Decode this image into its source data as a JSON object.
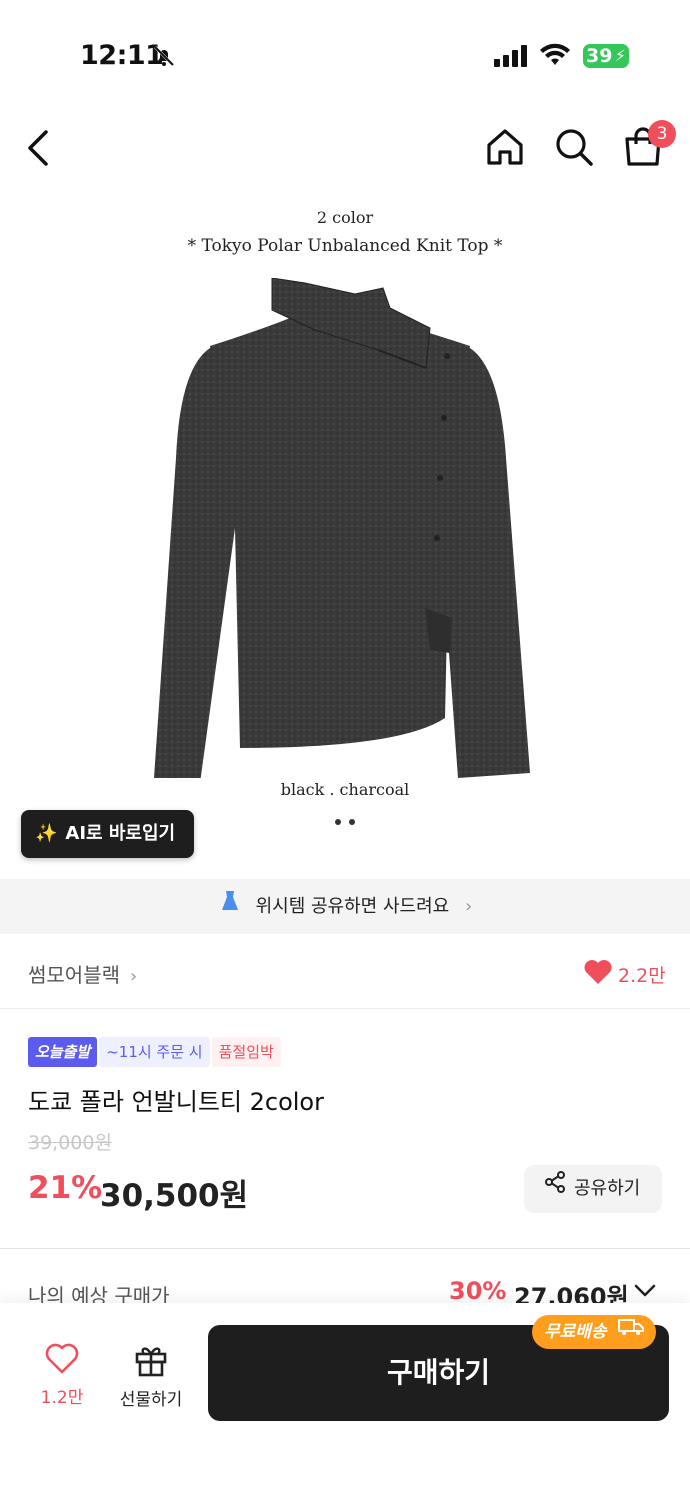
{
  "status_bar": {
    "time": "12:11",
    "battery": "39"
  },
  "header": {
    "cart_count": "3"
  },
  "hero": {
    "caption_top": "2 color",
    "caption_title": "* Tokyo Polar Unbalanced Knit Top *",
    "caption_colors": "black . charcoal",
    "ai_button_label": "AI로 바로입기"
  },
  "wish_banner": {
    "label": "위시템 공유하면 사드려요"
  },
  "brand": {
    "name": "썸모어블랙",
    "like_count": "2.2만"
  },
  "product": {
    "badges": [
      "오늘출발",
      "~11시 주문 시",
      "품절임박"
    ],
    "name": "도쿄 폴라 언발니트티 2color",
    "original_price": "39,000원",
    "discount": "21%",
    "sale_price": "30,500원",
    "share_label": "공유하기"
  },
  "expected": {
    "label": "나의 예상 구매가",
    "discount": "30%",
    "price": "27,060원"
  },
  "bottom_bar": {
    "wish_count": "1.2만",
    "gift_label": "선물하기",
    "buy_label": "구매하기",
    "free_shipping_label": "무료배송"
  },
  "colors": {
    "accent_red": "#f14e5b",
    "today_badge": "#5b5bf0",
    "free_ship_orange": "#ff9d1c",
    "buy_button": "#1e1e1e"
  }
}
